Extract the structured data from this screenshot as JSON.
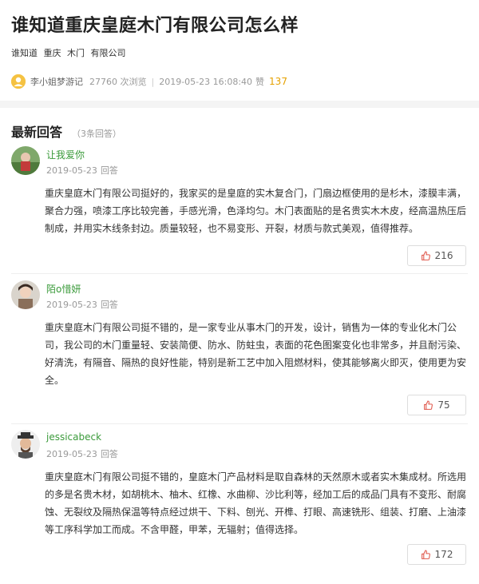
{
  "page": {
    "title": "谁知道重庆皇庭木门有限公司怎么样",
    "tags": [
      "谁知道",
      "重庆",
      "木门",
      "有限公司"
    ],
    "meta": {
      "author": "李小姐梦游记",
      "views": "27760 次浏览",
      "datetime": "2019-05-23 16:08:40",
      "like_label": "赞",
      "like_count": "137"
    }
  },
  "answers_section": {
    "heading": "最新回答",
    "count": "（3条回答）"
  },
  "answers": [
    {
      "user": "让我爱你",
      "date": "2019-05-23",
      "reply_label": "回答",
      "text": "重庆皇庭木门有限公司挺好的，我家买的是皇庭的实木复合门，门扇边框使用的是杉木，漆膜丰满，聚合力强，喷漆工序比较完善，手感光滑，色泽均匀。木门表面贴的是名贵实木木皮，经高温热压后制成，并用实木线条封边。质量较轻，也不易变形、开裂，材质与款式美观，值得推荐。",
      "likes": "216"
    },
    {
      "user": "陌o惜妍",
      "date": "2019-05-23",
      "reply_label": "回答",
      "text": "重庆皇庭木门有限公司挺不错的，是一家专业从事木门的开发，设计，销售为一体的专业化木门公司，我公司的木门重量轻、安装简便、防水、防蛀虫，表面的花色图案变化也非常多，并且耐污染、好清洗，有隔音、隔热的良好性能，特别是新工艺中加入阻燃材料，使其能够离火即灭，使用更为安全。",
      "likes": "75"
    },
    {
      "user": "jessicabeck",
      "date": "2019-05-23",
      "reply_label": "回答",
      "text": "重庆皇庭木门有限公司挺不错的，皇庭木门产品材料是取自森林的天然原木或者实木集成材。所选用的多是名贵木材，如胡桃木、柚木、红橡、水曲柳、沙比利等，经加工后的成品门具有不变形、耐腐蚀、无裂纹及隔热保温等特点经过烘干、下料、刨光、开榫、打眼、高速铣形、组装、打磨、上油漆等工序科学加工而成。不含甲醛，甲苯，无辐射；值得选择。",
      "likes": "172"
    }
  ],
  "colors": {
    "accent_gold": "#e5a100",
    "username_green": "#3a9a3a"
  },
  "icons": {
    "like": "thumbs-up-icon"
  }
}
